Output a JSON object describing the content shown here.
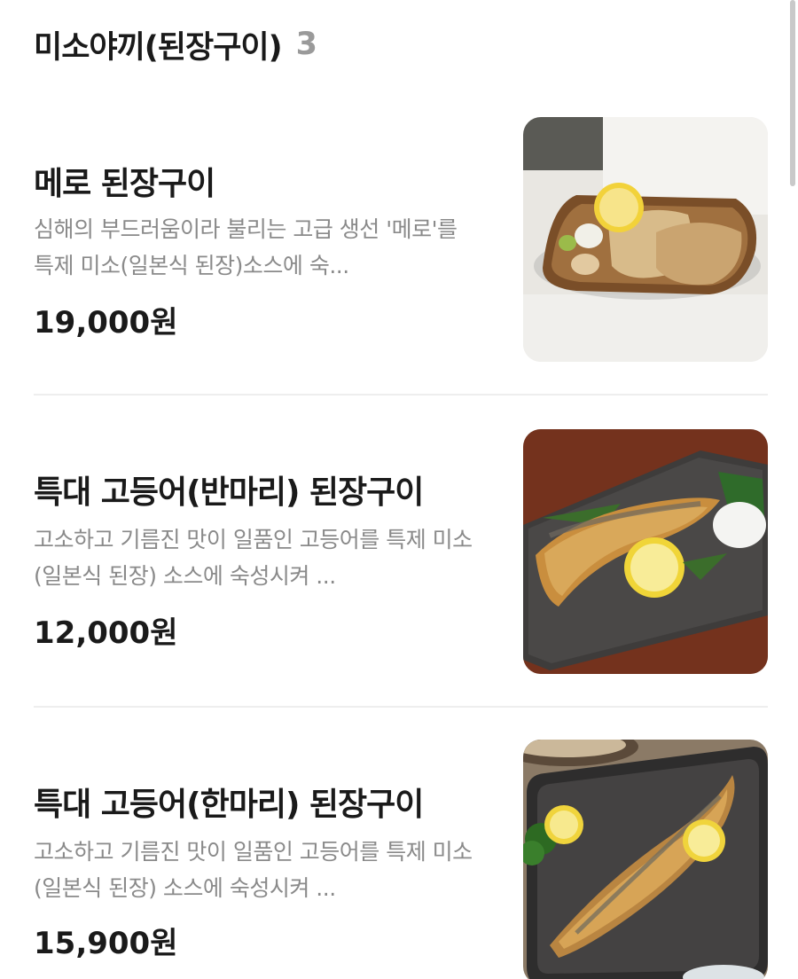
{
  "section": {
    "title": "미소야끼(된장구이)",
    "count": "3"
  },
  "items": [
    {
      "name": "메로 된장구이",
      "description": "심해의 부드러움이라 불리는 고급 생선 '메로'를 특제 미소(일본식 된장)소스에 숙...",
      "price": "19,000원",
      "photo_icon": "grilled-fish-fillet-photo"
    },
    {
      "name": "특대 고등어(반마리) 된장구이",
      "description": "고소하고 기름진 맛이 일품인 고등어를 특제 미소(일본식 된장) 소스에 숙성시켜 ...",
      "price": "12,000원",
      "photo_icon": "grilled-mackerel-half-photo"
    },
    {
      "name": "특대 고등어(한마리) 된장구이",
      "description": "고소하고 기름진 맛이 일품인 고등어를 특제 미소(일본식 된장) 소스에 숙성시켜 ...",
      "price": "15,900원",
      "photo_icon": "grilled-mackerel-whole-photo"
    }
  ]
}
